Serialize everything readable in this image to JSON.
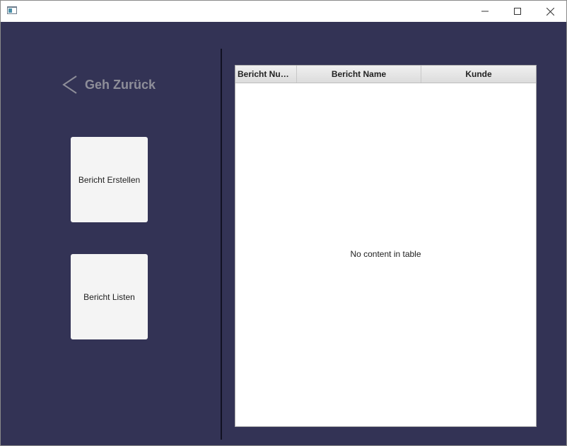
{
  "window": {
    "title": "",
    "controls": {
      "minimize": "minimize-icon",
      "maximize": "maximize-icon",
      "close": "close-icon"
    }
  },
  "sidebar": {
    "back_label": "Geh Zurück",
    "back_icon": "chevron-left-icon",
    "buttons": [
      {
        "label": "Bericht Erstellen"
      },
      {
        "label": "Bericht Listen"
      }
    ]
  },
  "table": {
    "columns": [
      "Bericht Num...",
      "Bericht Name",
      "Kunde"
    ],
    "rows": [],
    "placeholder": "No content in table"
  },
  "colors": {
    "background": "#333355",
    "button": "#f4f4f4",
    "back_text": "#8e8e99"
  }
}
